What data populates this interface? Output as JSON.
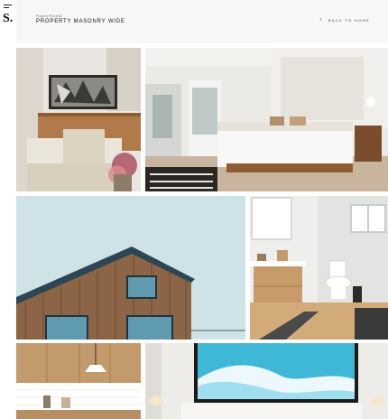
{
  "sidebar": {
    "logo": "S.",
    "menu_icon": "hamburger-icon"
  },
  "header": {
    "subtitle": "Property Portfolio",
    "title": "PROPERTY MASONRY WIDE",
    "back_label": "BACK TO HOME",
    "back_icon": "chevron-left-icon"
  },
  "gallery": {
    "items": [
      "living-room-photo",
      "bedroom-photo",
      "wooden-house-photo",
      "bathroom-photo",
      "kitchen-photo",
      "living-room-with-wave-painting-photo"
    ]
  }
}
